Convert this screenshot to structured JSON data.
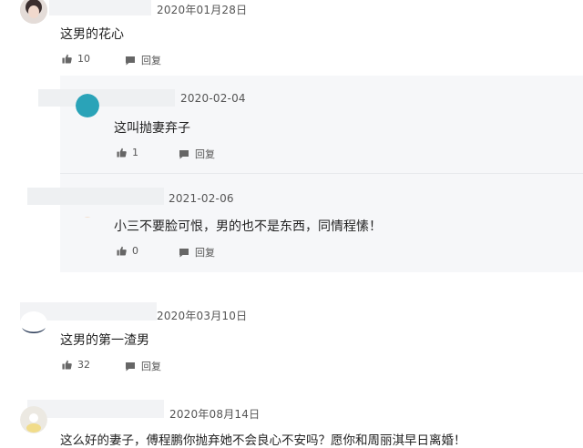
{
  "comments": [
    {
      "date": "2020年01月28日",
      "text": "这男的花心",
      "likes": "10",
      "reply_label": "回复"
    },
    {
      "date": "2020年03月10日",
      "text": "这男的第一渣男",
      "likes": "32",
      "reply_label": "回复"
    },
    {
      "date": "2020年08月14日",
      "text": "这么好的妻子，傅程鹏你抛弃她不会良心不安吗？愿你和周丽淇早日离婚！"
    }
  ],
  "replies": [
    {
      "date": "2020-02-04",
      "text": "这叫抛妻弃子",
      "likes": "1",
      "reply_label": "回复"
    },
    {
      "date": "2021-02-06",
      "text": "小三不要脸可恨，男的也不是东西，同情程愫！",
      "likes": "0",
      "reply_label": "回复"
    }
  ],
  "colors": {
    "reply_background": "#f6f7f9",
    "name_mask": "#f2f3f5",
    "text": "#222222",
    "meta": "#555555"
  },
  "icons": {
    "like": "thumbs-up-icon",
    "reply": "speech-bubble-icon"
  }
}
